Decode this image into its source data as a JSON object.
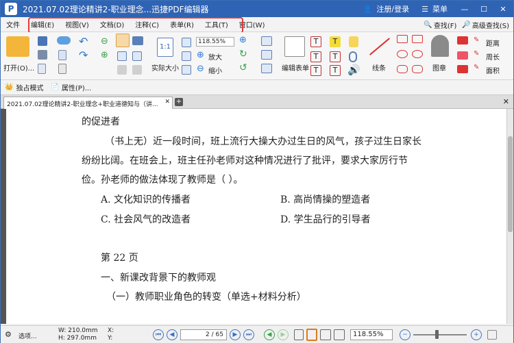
{
  "titlebar": {
    "logo": "P",
    "title": "2021.07.02理论精讲2-职业理念...迅捷PDF编辑器",
    "user_label": "注册/登录",
    "menu_label": "菜单"
  },
  "menubar": {
    "items": [
      "文件",
      "编辑(E)",
      "视图(V)",
      "文档(D)",
      "注释(C)",
      "表单(R)",
      "工具(T)",
      "窗口(W)"
    ],
    "find_label": "查找(F)",
    "advanced_find_label": "高级查找(S)"
  },
  "ribbon": {
    "open_label": "打开(O)...",
    "zoom_value": "118.55%",
    "actual_size_label": "实际大小",
    "zoom_in_label": "放大",
    "zoom_out_label": "缩小",
    "edit_form_label": "编辑表单",
    "line_label": "线条",
    "stamp_label": "图章",
    "distance_label": "距离",
    "perimeter_label": "周长",
    "area_label": "面积"
  },
  "toolbar2": {
    "exclusive_mode_label": "独占模式",
    "properties_label": "属性(P)..."
  },
  "tabs": {
    "active_tab": "2021.07.02理论精讲2-职业理念+职业道德知与（讲..."
  },
  "document": {
    "line1": "的促进者",
    "para1_a": "（书上无）近一段时间，班上流行大操大办过生日的风气，孩子过生日家长",
    "para1_b": "纷纷比阔。在班会上，班主任孙老师对这种情况进行了批评，要求大家厉行节",
    "para1_c": "俭。孙老师的做法体现了教师是（   ）。",
    "option_a": "A. 文化知识的传播者",
    "option_b": "B. 高尚情操的塑造者",
    "option_c": "C. 社会风气的改造者",
    "option_d": "D. 学生品行的引导者",
    "page_label": "第 22 页",
    "heading1": "一、新课改背景下的教师观",
    "heading2": "（一）教师职业角色的转变（单选+材料分析）"
  },
  "statusbar": {
    "options_label": "选项...",
    "width_label": "W: 210.0mm",
    "height_label": "H: 297.0mm",
    "x_label": "X:",
    "y_label": "Y:",
    "current_page": "2",
    "total_pages": "/ 65",
    "zoom_value": "118.55%"
  }
}
